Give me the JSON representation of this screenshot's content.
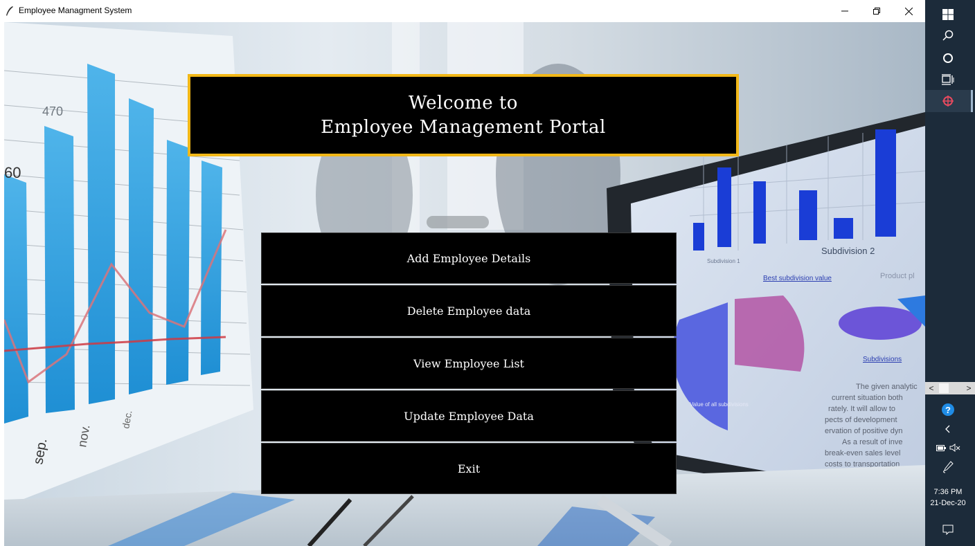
{
  "window": {
    "title": "Employee Managment System",
    "controls": {
      "minimize": "minimize",
      "maximize": "restore",
      "close": "close"
    }
  },
  "banner": {
    "line1": "Welcome to",
    "line2": "Employee Management Portal",
    "border_color": "#f2b818",
    "background": "#000000"
  },
  "menu": {
    "items": [
      {
        "label": "Add Employee Details"
      },
      {
        "label": "Delete Employee data"
      },
      {
        "label": "View Employee List"
      },
      {
        "label": "Update Employee Data"
      },
      {
        "label": "Exit"
      }
    ]
  },
  "background_image": {
    "description_icons": [
      "bar-chart",
      "laptop",
      "handshake",
      "pie-chart"
    ],
    "left_chart_labels": [
      "470",
      "60",
      "sep.",
      "nov.",
      "dec."
    ],
    "right_screen_labels": [
      "Subdivision 1",
      "Subdivision 2",
      "Best subdivision value",
      "Product pl",
      "Subdivisions"
    ]
  },
  "taskbar": {
    "icons": [
      "windows-start-icon",
      "search-icon",
      "cortana-icon",
      "task-view-icon",
      "app-running-icon",
      "help-icon",
      "chevron-left-icon",
      "battery-icon",
      "volume-muted-icon",
      "pen-icon",
      "notification-icon"
    ],
    "time": "7:36 PM",
    "date": "21-Dec-20",
    "scroll_left": "<",
    "scroll_right": ">"
  }
}
